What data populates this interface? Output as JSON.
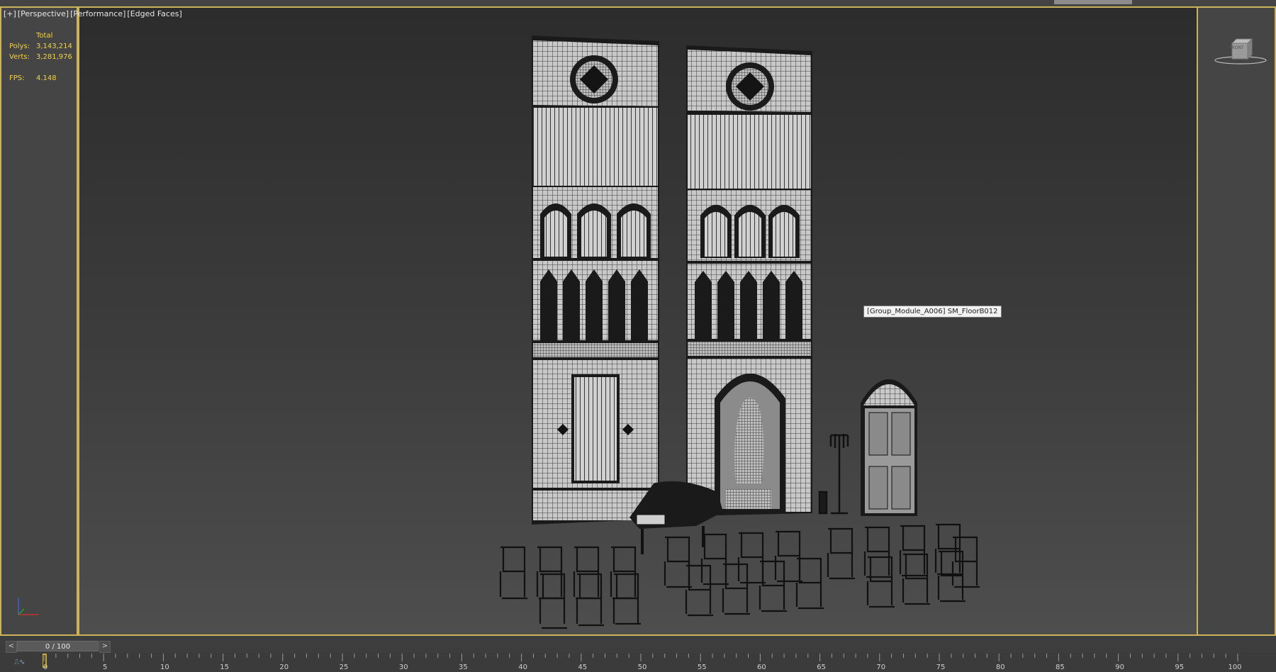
{
  "viewport": {
    "label_parts": [
      "[+]",
      "[Perspective]",
      "[Performance]",
      "[Edged Faces]"
    ],
    "tooltip": "[Group_Module_A006] SM_FloorB012",
    "viewcube_label": "FRONT"
  },
  "stats": {
    "header": "Total",
    "polys_label": "Polys:",
    "polys_value": "3,143,214",
    "verts_label": "Verts:",
    "verts_value": "3,281,976",
    "fps_label": "FPS:",
    "fps_value": "4.148"
  },
  "timeline": {
    "frame_display": "0 / 100",
    "prev_label": "<",
    "next_label": ">",
    "current_frame": 0,
    "range": [
      0,
      100
    ],
    "tick_labels": [
      "0",
      "5",
      "10",
      "15",
      "20",
      "25",
      "30",
      "35",
      "40",
      "45",
      "50",
      "55",
      "60",
      "65",
      "70",
      "75",
      "80",
      "85",
      "90",
      "95",
      "100"
    ]
  },
  "colors": {
    "viewport_border": "#cbb35a",
    "stats_text": "#f0d24a",
    "wire": "#111111",
    "surface": "#c9c9c9"
  },
  "icons": {
    "axis": "xyz-axis-gizmo",
    "viewcube": "viewcube-icon",
    "track": "curve-editor-icon"
  }
}
